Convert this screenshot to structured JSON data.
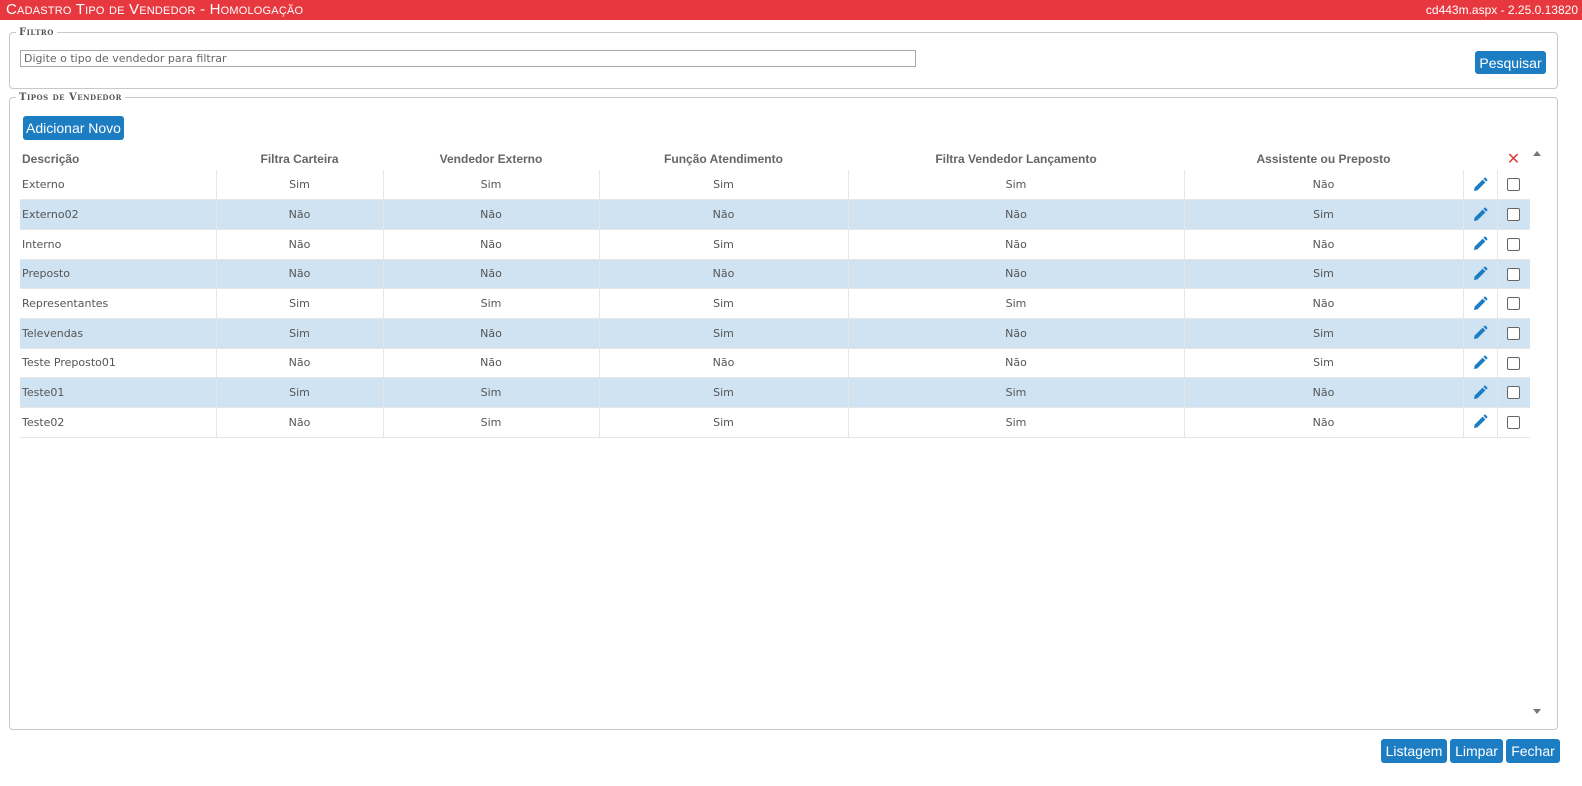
{
  "titlebar": {
    "title": "Cadastro Tipo de Vendedor  - Homologação",
    "version": "cd443m.aspx - 2.25.0.13820"
  },
  "filter": {
    "legend": "Filtro",
    "placeholder": "Digite o tipo de vendedor para filtrar",
    "value": "",
    "search_label": "Pesquisar"
  },
  "list": {
    "legend": "Tipos de Vendedor",
    "add_label": "Adicionar Novo",
    "columns": [
      "Descrição",
      "Filtra Carteira",
      "Vendedor Externo",
      "Função Atendimento",
      "Filtra Vendedor Lançamento",
      "Assistente ou Preposto"
    ],
    "delete_header": "✕",
    "rows": [
      [
        "Externo",
        "Sim",
        "Sim",
        "Sim",
        "Sim",
        "Não"
      ],
      [
        "Externo02",
        "Não",
        "Não",
        "Não",
        "Não",
        "Sim"
      ],
      [
        "Interno",
        "Não",
        "Não",
        "Sim",
        "Não",
        "Não"
      ],
      [
        "Preposto",
        "Não",
        "Não",
        "Não",
        "Não",
        "Sim"
      ],
      [
        "Representantes",
        "Sim",
        "Sim",
        "Sim",
        "Sim",
        "Não"
      ],
      [
        "Televendas",
        "Sim",
        "Não",
        "Sim",
        "Não",
        "Sim"
      ],
      [
        "Teste Preposto01",
        "Não",
        "Não",
        "Não",
        "Não",
        "Sim"
      ],
      [
        "Teste01",
        "Sim",
        "Sim",
        "Sim",
        "Sim",
        "Não"
      ],
      [
        "Teste02",
        "Não",
        "Sim",
        "Sim",
        "Sim",
        "Não"
      ]
    ]
  },
  "footer": {
    "list_label": "Listagem",
    "clear_label": "Limpar",
    "close_label": "Fechar"
  },
  "colors": {
    "titlebar": "#e8383f",
    "button": "#1d7dc2",
    "row_alt": "#cfe3f3",
    "delete_icon": "#e03c3c"
  },
  "icons": {
    "edit": "pencil-icon",
    "delete": "close-icon",
    "select": "checkbox"
  }
}
